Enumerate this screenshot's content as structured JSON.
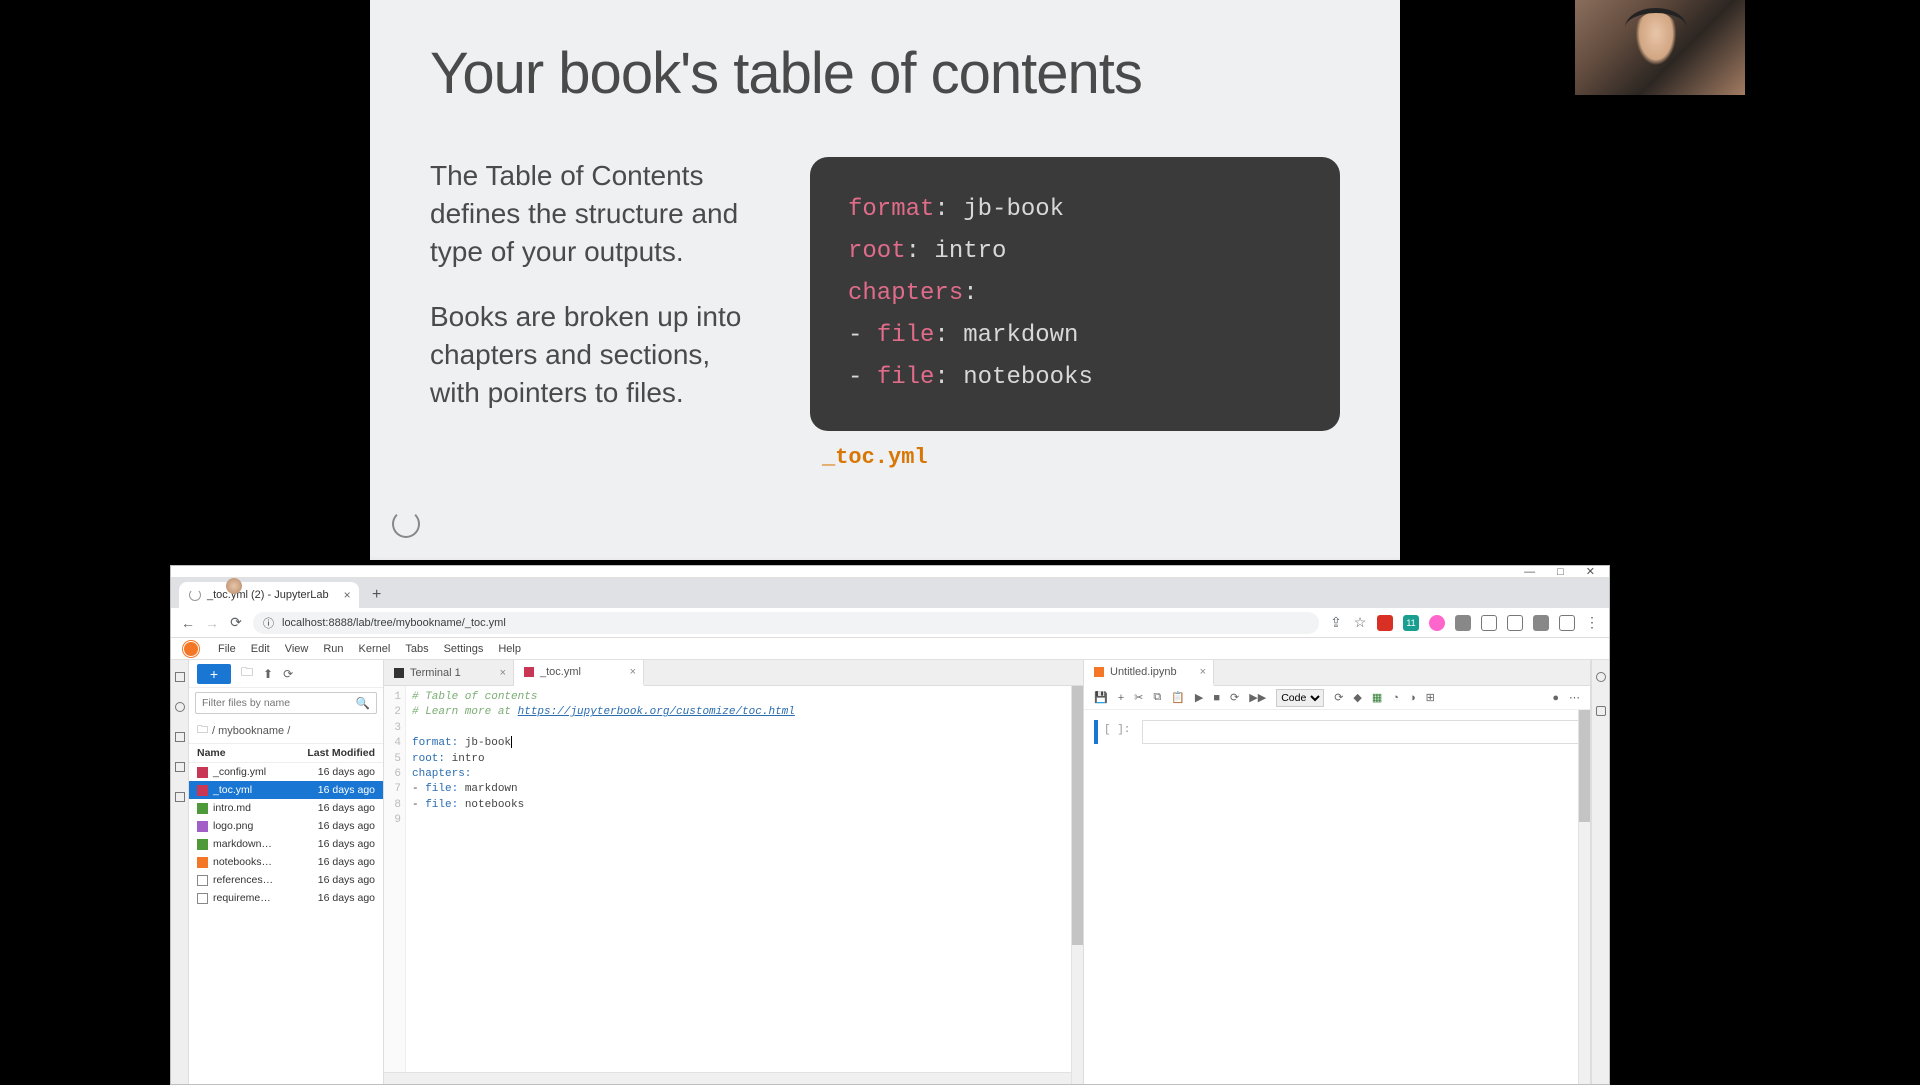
{
  "slide": {
    "title": "Your book's table of contents",
    "para1": "The Table of Contents defines the structure and type of your outputs.",
    "para2": "Books are broken up into chapters and sections, with pointers to files.",
    "code": {
      "format_key": "format",
      "format_val": " jb-book",
      "root_key": "root",
      "root_val": " intro",
      "chapters_key": "chapters",
      "file_key": "file",
      "file1": " markdown",
      "file2": " notebooks"
    },
    "code_label": "_toc.yml"
  },
  "browser": {
    "win": {
      "min": "—",
      "max": "□",
      "close": "✕"
    },
    "tab_title": "_toc.yml (2) - JupyterLab",
    "url": "localhost:8888/lab/tree/mybookname/_toc.yml",
    "lock": "ⓘ",
    "ublock_badge": "11",
    "menus": [
      "File",
      "Edit",
      "View",
      "Run",
      "Kernel",
      "Tabs",
      "Settings",
      "Help"
    ]
  },
  "files": {
    "filter_placeholder": "Filter files by name",
    "breadcrumb": "/ mybookname /",
    "head_name": "Name",
    "head_mod": "Last Modified",
    "rows": [
      {
        "icon": "yml",
        "name": "_config.yml",
        "mod": "16 days ago"
      },
      {
        "icon": "yml",
        "name": "_toc.yml",
        "mod": "16 days ago",
        "selected": true
      },
      {
        "icon": "md",
        "name": "intro.md",
        "mod": "16 days ago"
      },
      {
        "icon": "img",
        "name": "logo.png",
        "mod": "16 days ago"
      },
      {
        "icon": "md",
        "name": "markdown…",
        "mod": "16 days ago"
      },
      {
        "icon": "nb",
        "name": "notebooks…",
        "mod": "16 days ago"
      },
      {
        "icon": "txt",
        "name": "references…",
        "mod": "16 days ago"
      },
      {
        "icon": "txt",
        "name": "requireme…",
        "mod": "16 days ago"
      }
    ]
  },
  "editor": {
    "tabs": [
      {
        "icon": "term",
        "label": "Terminal 1"
      },
      {
        "icon": "yml",
        "label": "_toc.yml",
        "active": true
      }
    ],
    "lines": {
      "c1": "# Table of contents",
      "c2a": "# Learn more at ",
      "c2b": "https://jupyterbook.org/customize/toc.html",
      "l4k": "format:",
      "l4v": " jb-book",
      "l5k": "root:",
      "l5v": " intro",
      "l6k": "chapters:",
      "l7a": "- ",
      "l7k": "file:",
      "l7v": " markdown",
      "l8a": "- ",
      "l8k": "file:",
      "l8v": " notebooks"
    }
  },
  "notebook": {
    "tab": "Untitled.ipynb",
    "celltype": "Code",
    "prompt": "[ ]:"
  }
}
